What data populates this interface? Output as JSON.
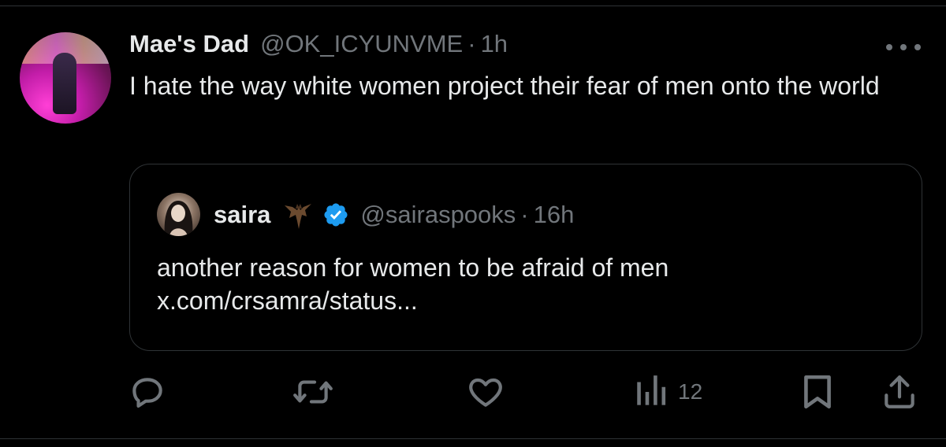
{
  "tweet": {
    "display_name": "Mae's Dad",
    "handle": "@OK_ICYUNVME",
    "separator": "·",
    "time": "1h",
    "text": "I hate the way white women project their fear of men onto the world",
    "avatar_icon": "profile-photo",
    "more_icon": "more-horizontal-icon"
  },
  "quoted": {
    "display_name": "saira",
    "name_emoji": "bat",
    "verified": true,
    "handle": "@sairaspooks",
    "separator": "·",
    "time": "16h",
    "text": "another reason for women to be afraid of men",
    "link": "x.com/crsamra/status..."
  },
  "actions": {
    "reply_icon": "reply-icon",
    "retweet_icon": "retweet-icon",
    "like_icon": "heart-icon",
    "views_icon": "views-icon",
    "views_count": "12",
    "bookmark_icon": "bookmark-icon",
    "share_icon": "share-icon"
  },
  "colors": {
    "background": "#000000",
    "text_primary": "#e7e9ea",
    "text_secondary": "#71767b",
    "border": "#2f3336",
    "verified_blue": "#1d9bf0"
  }
}
